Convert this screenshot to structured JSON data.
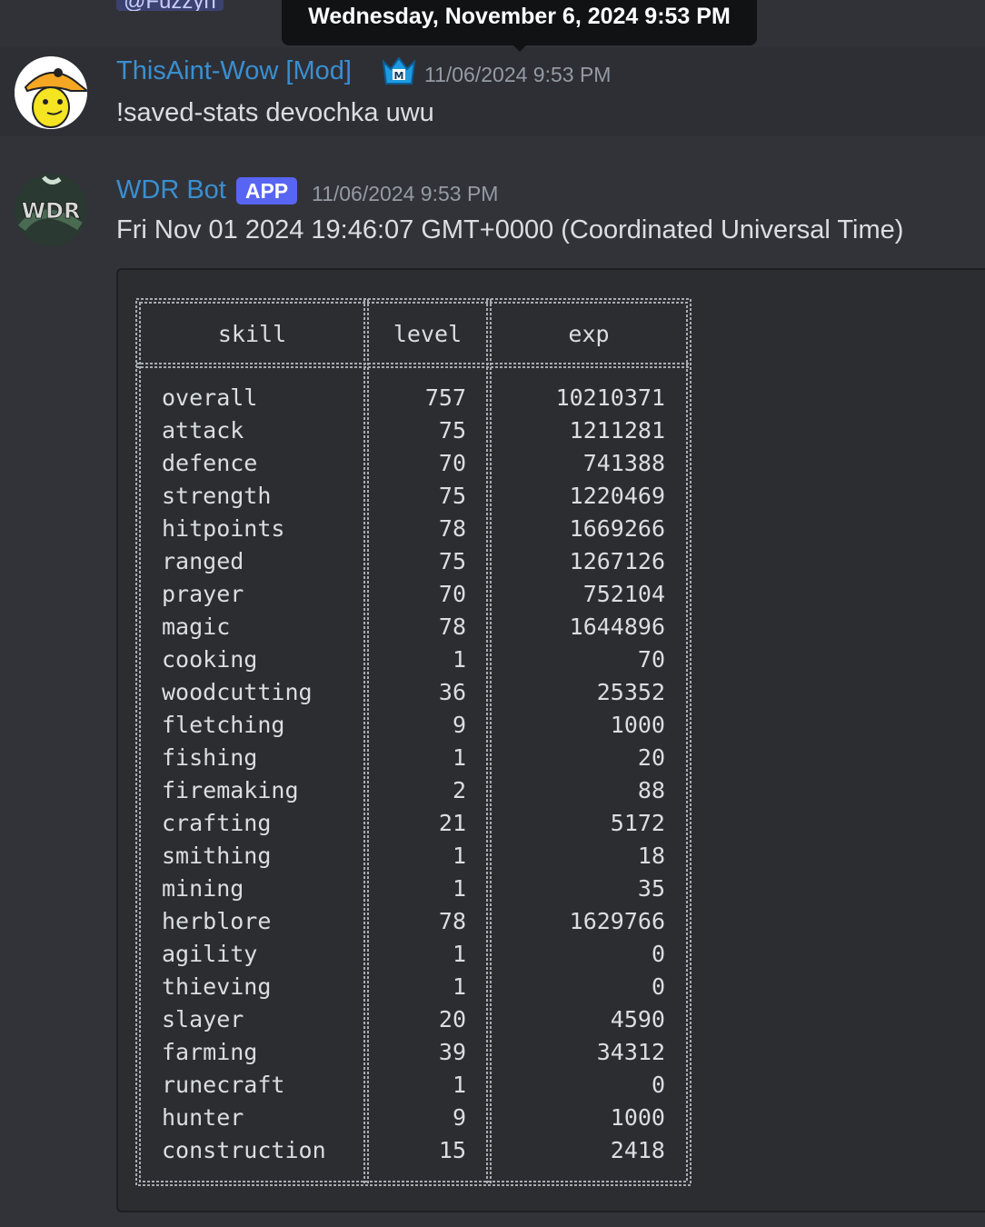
{
  "top": {
    "mention": "@Fuzzyh",
    "tooltip": "Wednesday, November 6, 2024 9:53 PM"
  },
  "message1": {
    "author": "ThisAint-Wow [Mod]",
    "timestamp": "11/06/2024 9:53 PM",
    "content": "!saved-stats devochka uwu",
    "badge_icon": "mod-crown-icon"
  },
  "message2": {
    "author": "WDR Bot",
    "app_badge": "APP",
    "timestamp": "11/06/2024 9:53 PM",
    "content": "Fri Nov 01 2024 19:46:07 GMT+0000 (Coordinated Universal Time)",
    "avatar_text": "WDR"
  },
  "table": {
    "headers": [
      "skill",
      "level",
      "exp"
    ],
    "rows": [
      [
        "overall",
        "757",
        "10210371"
      ],
      [
        "attack",
        "75",
        "1211281"
      ],
      [
        "defence",
        "70",
        "741388"
      ],
      [
        "strength",
        "75",
        "1220469"
      ],
      [
        "hitpoints",
        "78",
        "1669266"
      ],
      [
        "ranged",
        "75",
        "1267126"
      ],
      [
        "prayer",
        "70",
        "752104"
      ],
      [
        "magic",
        "78",
        "1644896"
      ],
      [
        "cooking",
        "1",
        "70"
      ],
      [
        "woodcutting",
        "36",
        "25352"
      ],
      [
        "fletching",
        "9",
        "1000"
      ],
      [
        "fishing",
        "1",
        "20"
      ],
      [
        "firemaking",
        "2",
        "88"
      ],
      [
        "crafting",
        "21",
        "5172"
      ],
      [
        "smithing",
        "1",
        "18"
      ],
      [
        "mining",
        "1",
        "35"
      ],
      [
        "herblore",
        "78",
        "1629766"
      ],
      [
        "agility",
        "1",
        "0"
      ],
      [
        "thieving",
        "1",
        "0"
      ],
      [
        "slayer",
        "20",
        "4590"
      ],
      [
        "farming",
        "39",
        "34312"
      ],
      [
        "runecraft",
        "1",
        "0"
      ],
      [
        "hunter",
        "9",
        "1000"
      ],
      [
        "construction",
        "15",
        "2418"
      ]
    ]
  },
  "colors": {
    "background": "#323339",
    "author": "#3a8fd0",
    "app_badge": "#5865f2",
    "timestamp": "#949ba4",
    "text": "#dbdee1"
  }
}
